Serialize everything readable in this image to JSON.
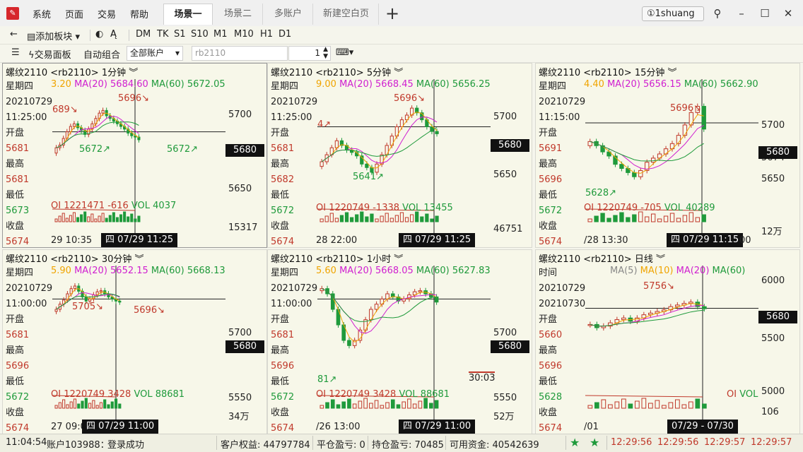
{
  "menu": {
    "items": [
      "系统",
      "页面",
      "交易",
      "帮助"
    ]
  },
  "tabs": [
    "场景一",
    "场景二",
    "多账户",
    "新建空白页"
  ],
  "user": {
    "name": "1shuang"
  },
  "toolbar1": {
    "add_block": "添加板块",
    "periods": [
      "DM",
      "TK",
      "S1",
      "S10",
      "M1",
      "M10",
      "H1",
      "D1"
    ]
  },
  "toolbar2": {
    "trade_panel": "交易面板",
    "auto_combo": "自动组合",
    "account_select": "全部账户",
    "contract_input": "rb2110",
    "quantity": "1"
  },
  "info_labels": {
    "weekday": "星期四",
    "open": "开盘",
    "high": "最高",
    "low": "最低",
    "close": "收盘",
    "time": "时间"
  },
  "panels": [
    {
      "title": "螺纹2110 <rb2110> 1分钟 ︾",
      "date": "20210729",
      "time": "11:25:00",
      "open": "5681",
      "high": "5681",
      "low": "5673",
      "close": "5674",
      "ma_cut": "3.20",
      "ma20": "MA(20) 5684.60",
      "ma60": "MA(60) 5672.05",
      "y_labels": [
        "5700",
        "5674",
        "5650",
        "15317"
      ],
      "cur_price": "5680",
      "oi": "OI 1221471 -616",
      "vol": "VOL 4037",
      "x_left": "29 10:35",
      "cross_time": "四 07/29 11:25",
      "annots": [
        "689↘",
        "5696↘",
        "5672↗",
        "5672↗"
      ]
    },
    {
      "title": "螺纹2110 <rb2110> 5分钟 ︾",
      "date": "20210729",
      "time": "11:25:00",
      "open": "5681",
      "high": "5682",
      "low": "5672",
      "close": "5674",
      "ma_cut": "9.00",
      "ma20": "MA(20) 5668.45",
      "ma60": "MA(60) 5656.25",
      "y_labels": [
        "5700",
        "5674",
        "5650",
        "46751"
      ],
      "cur_price": "5680",
      "oi": "OI 1220749 -1338",
      "vol": "VOL 13455",
      "x_left": "28 22:00",
      "cross_time": "四 07/29 11:25",
      "annots": [
        "4↗",
        "5696↘",
        "5641↗"
      ]
    },
    {
      "title": "螺纹2110 <rb2110> 15分钟 ︾",
      "date": "20210729",
      "time": "11:15:00",
      "open": "5691",
      "high": "5696",
      "low": "5672",
      "close": "5674",
      "ma_cut": "4.40",
      "ma20": "MA(20) 5656.15",
      "ma60": "MA(60) 5662.90",
      "y_labels": [
        "5700",
        "5674",
        "5650",
        "12万"
      ],
      "cur_price": "5680",
      "oi": "OI 1220749 -705",
      "vol": "VOL 40289",
      "x_left": "/28 13:30",
      "cross_time": "四 07/29 11:15",
      "cross_extra": "00",
      "annots": [
        "5696↘",
        "5628↗"
      ]
    },
    {
      "title": "螺纹2110 <rb2110> 30分钟 ︾",
      "date": "20210729",
      "time": "11:00:00",
      "open": "5681",
      "high": "5696",
      "low": "5672",
      "close": "5674",
      "ma_cut": "5.90",
      "ma20": "MA(20) 5652.15",
      "ma60": "MA(60) 5668.13",
      "y_labels": [
        "5700",
        "5550",
        "34万"
      ],
      "cur_price": "5680",
      "oi": "OI 1220749 3428",
      "vol": "VOL 88681",
      "x_left": "27 09:00",
      "cross_time": "四 07/29 11:00",
      "annots": [
        "5705↘",
        "5696↘"
      ]
    },
    {
      "title": "螺纹2110 <rb2110> 1小时 ︾",
      "date": "20210729",
      "time": "11:00:00",
      "open": "5681",
      "high": "5696",
      "low": "5672",
      "close": "5674",
      "ma_cut": "5.60",
      "ma20": "MA(20) 5668.05",
      "ma60": "MA(60) 5627.83",
      "y_labels": [
        "5700",
        "5550",
        "52万"
      ],
      "cur_price": "5680",
      "oi": "OI 1220749 3428",
      "vol": "VOL 88681",
      "x_left": "/26 13:00",
      "cross_time": "四 07/29 11:00",
      "countdown": "30:03",
      "annots": [
        "81↗"
      ]
    },
    {
      "title": "螺纹2110 <rb2110> 日线 ︾",
      "date": "20210729",
      "time": "20210730",
      "open": "5660",
      "high": "5696",
      "low": "5628",
      "close": "5674",
      "ma5": "MA(5)",
      "ma10": "MA(10)",
      "ma20": "MA(20)",
      "ma60": "MA(60)",
      "y_labels": [
        "6000",
        "5500",
        "5000",
        "106"
      ],
      "cur_price": "5680",
      "oi": "OI",
      "vol": "VOL",
      "x_left": "/01",
      "cross_time": "07/29 - 07/30",
      "annots": [
        "5756↘"
      ]
    }
  ],
  "status": {
    "clock": "11:04:54",
    "account": "账户103988：",
    "login": "登录成功",
    "equity": "客户权益: 44797784",
    "close_pnl": "平仓盈亏: 0",
    "position_pnl": "持仓盈亏: 70485",
    "available": "可用资金: 40542639",
    "times": [
      "12:29:56",
      "12:29:56",
      "12:29:57",
      "12:29:57"
    ]
  },
  "colors": {
    "up": "#c0392b",
    "down": "#1f9a3b",
    "ma_short": "#f0a400",
    "ma20": "#d020d0",
    "ma60": "#1f9a3b"
  },
  "chart_data": [
    {
      "type": "candlestick",
      "title": "螺纹2110 <rb2110> 1分钟",
      "price_range": [
        5640,
        5710
      ],
      "current": 5680,
      "series": [
        {
          "name": "MA(20)",
          "value": 5684.6
        },
        {
          "name": "MA(60)",
          "value": 5672.05
        }
      ],
      "closes": [
        5668,
        5670,
        5675,
        5680,
        5684,
        5686,
        5683,
        5681,
        5678,
        5682,
        5686,
        5690,
        5694,
        5696,
        5692,
        5690,
        5688,
        5686,
        5684,
        5682,
        5679,
        5677,
        5676,
        5674
      ]
    },
    {
      "type": "candlestick",
      "title": "螺纹2110 <rb2110> 5分钟",
      "price_range": [
        5630,
        5710
      ],
      "current": 5680,
      "series": [
        {
          "name": "MA(20)",
          "value": 5668.45
        },
        {
          "name": "MA(60)",
          "value": 5656.25
        }
      ],
      "closes": [
        5650,
        5656,
        5662,
        5668,
        5664,
        5660,
        5658,
        5655,
        5648,
        5645,
        5641,
        5648,
        5656,
        5664,
        5672,
        5680,
        5686,
        5690,
        5696,
        5692,
        5686,
        5680,
        5676,
        5674
      ]
    },
    {
      "type": "candlestick",
      "title": "螺纹2110 <rb2110> 15分钟",
      "price_range": [
        5620,
        5710
      ],
      "current": 5680,
      "series": [
        {
          "name": "MA(20)",
          "value": 5656.15
        },
        {
          "name": "MA(60)",
          "value": 5662.9
        }
      ],
      "closes": [
        5662,
        5658,
        5652,
        5648,
        5640,
        5636,
        5632,
        5628,
        5634,
        5642,
        5646,
        5650,
        5655,
        5660,
        5668,
        5678,
        5690,
        5696,
        5674
      ]
    },
    {
      "type": "candlestick",
      "title": "螺纹2110 <rb2110> 30分钟",
      "price_range": [
        5540,
        5720
      ],
      "current": 5680,
      "series": [
        {
          "name": "MA(20)",
          "value": 5652.15
        },
        {
          "name": "MA(60)",
          "value": 5668.13
        }
      ],
      "closes": [
        5660,
        5670,
        5678,
        5690,
        5700,
        5705,
        5695,
        5684,
        5676,
        5680,
        5688,
        5694,
        5696,
        5690,
        5684,
        5680,
        5676,
        5674
      ]
    },
    {
      "type": "candlestick",
      "title": "螺纹2110 <rb2110> 1小时",
      "price_range": [
        5540,
        5720
      ],
      "current": 5680,
      "series": [
        {
          "name": "MA(20)",
          "value": 5668.05
        },
        {
          "name": "MA(60)",
          "value": 5627.83
        }
      ],
      "closes": [
        5700,
        5690,
        5660,
        5630,
        5600,
        5590,
        5600,
        5620,
        5640,
        5660,
        5670,
        5680,
        5690,
        5684,
        5676,
        5680,
        5688,
        5694,
        5696,
        5690,
        5684,
        5674
      ]
    },
    {
      "type": "candlestick",
      "title": "螺纹2110 <rb2110> 日线",
      "price_range": [
        4900,
        6050
      ],
      "current": 5680,
      "closes": [
        5480,
        5440,
        5460,
        5500,
        5540,
        5560,
        5520,
        5560,
        5600,
        5620,
        5640,
        5660,
        5700,
        5720,
        5740,
        5756,
        5700,
        5674
      ]
    }
  ]
}
